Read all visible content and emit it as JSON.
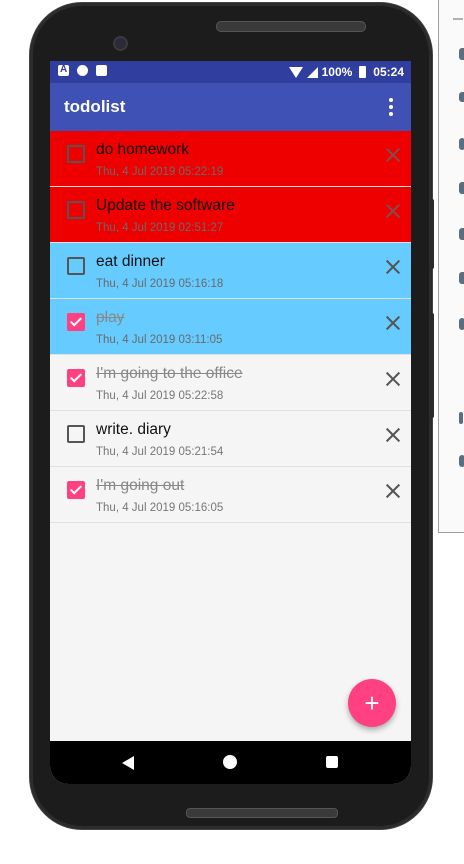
{
  "app": {
    "title": "todolist",
    "primary_color": "#3f51b5",
    "status_bar_color": "#303f9f",
    "accent_color": "#ff4081"
  },
  "status_bar": {
    "battery": "100%",
    "time": "05:24",
    "icons": [
      "android-a-icon",
      "circle-icon",
      "sd-card-icon",
      "wifi-icon",
      "signal-icon",
      "battery-icon"
    ]
  },
  "toolbar": {
    "overflow_icon": "more-vert-icon"
  },
  "tasks": [
    {
      "name": "do homework",
      "date": "Thu, 4 Jul 2019 05:22:19",
      "checked": false,
      "color": "#ee0000"
    },
    {
      "name": "Update the software",
      "date": "Thu, 4 Jul 2019 02:51:27",
      "checked": false,
      "color": "#ee0000"
    },
    {
      "name": "eat dinner",
      "date": "Thu, 4 Jul 2019 05:16:18",
      "checked": false,
      "color": "#66ccff"
    },
    {
      "name": "play",
      "date": "Thu, 4 Jul 2019 03:11:05",
      "checked": true,
      "color": "#66ccff"
    },
    {
      "name": "I'm going to the office",
      "date": "Thu, 4 Jul 2019 05:22:58",
      "checked": true,
      "color": "#f5f5f5"
    },
    {
      "name": "write. diary",
      "date": "Thu, 4 Jul 2019 05:21:54",
      "checked": false,
      "color": "#f5f5f5"
    },
    {
      "name": "I'm going out",
      "date": "Thu, 4 Jul 2019 05:16:05",
      "checked": true,
      "color": "#f5f5f5"
    }
  ],
  "fab": {
    "label": "+"
  },
  "nav": {
    "icons": [
      "back-icon",
      "home-icon",
      "recents-icon"
    ]
  }
}
